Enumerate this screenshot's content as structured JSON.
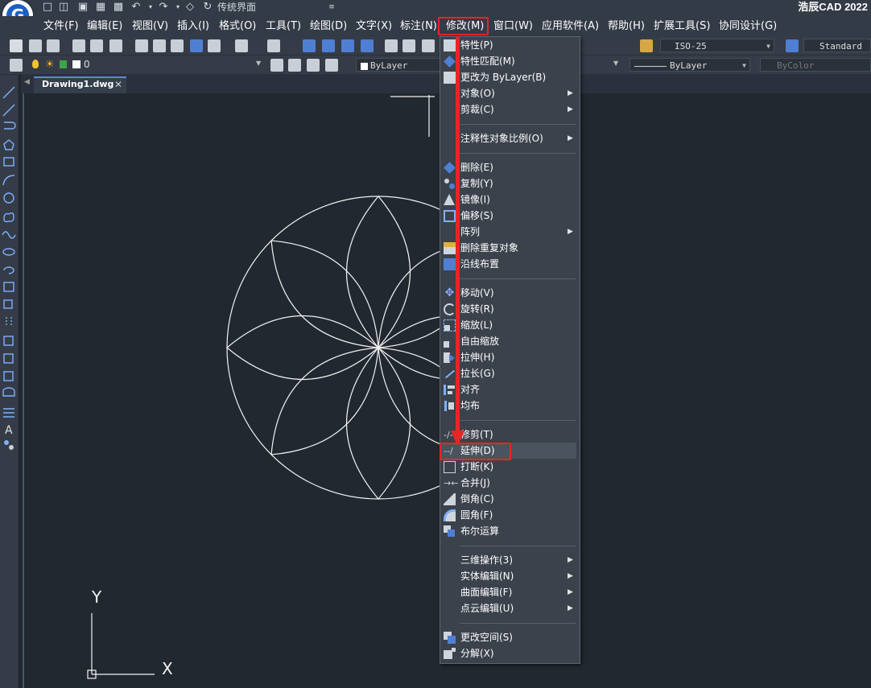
{
  "app": {
    "title": "浩辰CAD 2022",
    "workspace": "传统界面",
    "logo_letter": "G"
  },
  "menubar": {
    "items": [
      "文件(F)",
      "编辑(E)",
      "视图(V)",
      "插入(I)",
      "格式(O)",
      "工具(T)",
      "绘图(D)",
      "文字(X)",
      "标注(N)",
      "修改(M)",
      "窗口(W)",
      "应用软件(A)",
      "帮助(H)",
      "扩展工具(S)",
      "协同设计(G)"
    ],
    "active": "修改(M)"
  },
  "toolbar": {
    "dim_style": "ISO-25",
    "text_style": "Standard",
    "layer_name": "0",
    "color": "ByLayer",
    "linetype": "ByLayer",
    "lineweight": "ByColor"
  },
  "tab": {
    "label": "Drawing1.dwg",
    "close": "✕"
  },
  "ucs": {
    "y_label": "Y",
    "x_label": "X"
  },
  "modify_menu": {
    "items": [
      {
        "label": "特性(P)",
        "icon": "properties-icon"
      },
      {
        "label": "特性匹配(M)",
        "icon": "match-properties-icon"
      },
      {
        "label": "更改为 ByLayer(B)",
        "icon": "set-bylayer-icon"
      },
      {
        "label": "对象(O)",
        "submenu": true
      },
      {
        "label": "剪裁(C)",
        "submenu": true
      },
      {
        "label": "注释性对象比例(O)",
        "submenu": true
      },
      {
        "label": "删除(E)",
        "icon": "erase-icon"
      },
      {
        "label": "复制(Y)",
        "icon": "copy-icon"
      },
      {
        "label": "镜像(I)",
        "icon": "mirror-icon"
      },
      {
        "label": "偏移(S)",
        "icon": "offset-icon"
      },
      {
        "label": "阵列",
        "submenu": true
      },
      {
        "label": "删除重复对象",
        "icon": "delete-duplicates-icon"
      },
      {
        "label": "沿线布置",
        "icon": "along-line-icon"
      },
      {
        "label": "移动(V)",
        "icon": "move-icon"
      },
      {
        "label": "旋转(R)",
        "icon": "rotate-icon"
      },
      {
        "label": "缩放(L)",
        "icon": "scale-icon"
      },
      {
        "label": "自由缩放",
        "icon": "free-scale-icon"
      },
      {
        "label": "拉伸(H)",
        "icon": "stretch-icon"
      },
      {
        "label": "拉长(G)",
        "icon": "lengthen-icon"
      },
      {
        "label": "对齐",
        "icon": "align-icon"
      },
      {
        "label": "均布",
        "icon": "distribute-icon"
      },
      {
        "label": "修剪(T)",
        "icon": "trim-icon"
      },
      {
        "label": "延伸(D)",
        "icon": "extend-icon"
      },
      {
        "label": "打断(K)",
        "icon": "break-icon"
      },
      {
        "label": "合并(J)",
        "icon": "join-icon"
      },
      {
        "label": "倒角(C)",
        "icon": "chamfer-icon"
      },
      {
        "label": "圆角(F)",
        "icon": "fillet-icon"
      },
      {
        "label": "布尔运算",
        "icon": "boolean-icon"
      },
      {
        "label": "三维操作(3)",
        "submenu": true
      },
      {
        "label": "实体编辑(N)",
        "submenu": true
      },
      {
        "label": "曲面编辑(F)",
        "submenu": true
      },
      {
        "label": "点云编辑(U)",
        "submenu": true
      },
      {
        "label": "更改空间(S)",
        "icon": "change-space-icon"
      },
      {
        "label": "分解(X)",
        "icon": "explode-icon"
      }
    ],
    "highlighted": "延伸(D)"
  },
  "colors": {
    "highlight": "#e62626",
    "canvas": "#212830",
    "menu_bg": "#3b424c",
    "drawing_line": "#ffffff"
  }
}
